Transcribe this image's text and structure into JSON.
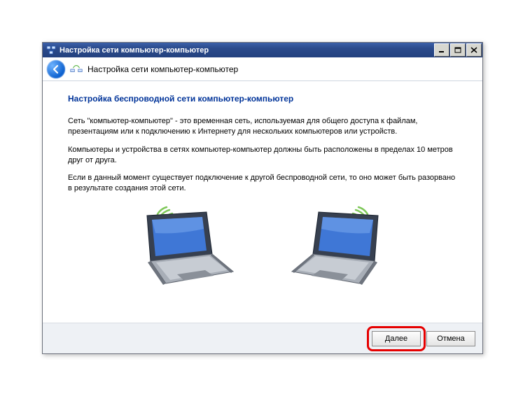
{
  "titlebar": {
    "title": "Настройка сети компьютер-компьютер"
  },
  "header": {
    "title": "Настройка сети компьютер-компьютер"
  },
  "content": {
    "heading": "Настройка беспроводной сети компьютер-компьютер",
    "p1": "Сеть \"компьютер-компьютер\" - это временная сеть, используемая для общего доступа к файлам, презентациям или к подключению к Интернету для нескольких компьютеров или устройств.",
    "p2": "Компьютеры и устройства в сетях компьютер-компьютер должны быть расположены в пределах 10 метров друг от друга.",
    "p3": "Если в данный момент существует подключение к другой беспроводной сети, то оно может быть разорвано в результате создания этой сети."
  },
  "footer": {
    "next": "Далее",
    "cancel": "Отмена"
  }
}
